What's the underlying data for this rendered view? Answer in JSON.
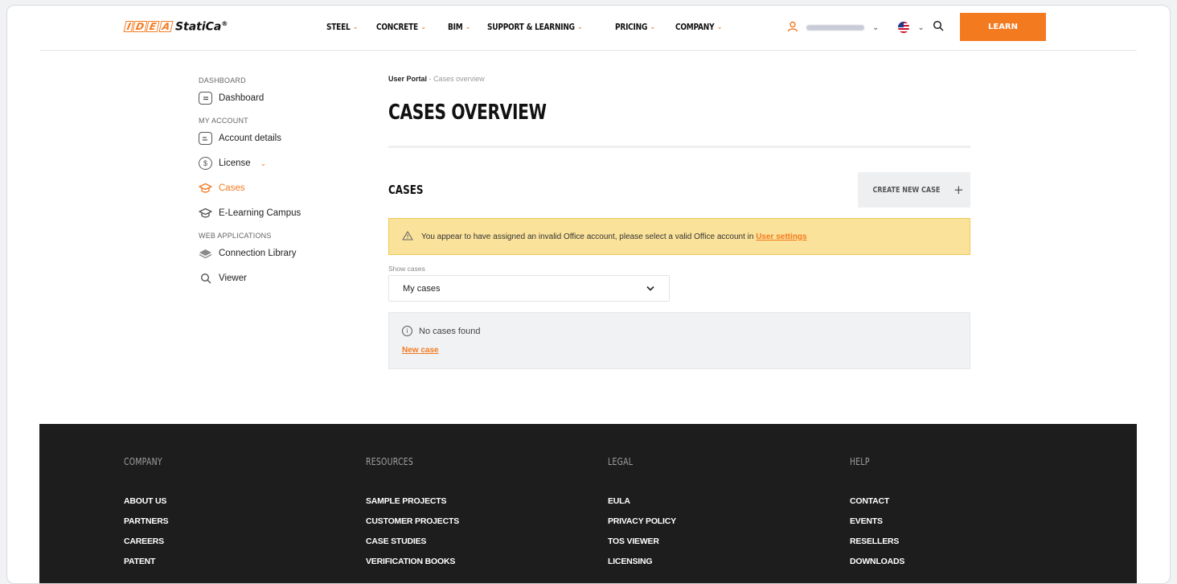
{
  "header": {
    "logo_mark": [
      "I",
      "D",
      "E",
      "A"
    ],
    "logo_text": "StatiCa",
    "logo_reg": "®",
    "nav": [
      {
        "label": "STEEL"
      },
      {
        "label": "CONCRETE"
      },
      {
        "label": "BIM"
      },
      {
        "label": "SUPPORT & LEARNING"
      },
      {
        "label": "PRICING"
      },
      {
        "label": "COMPANY"
      }
    ],
    "learn_label": "LEARN"
  },
  "sidebar": {
    "sections": [
      {
        "title": "DASHBOARD",
        "items": [
          {
            "label": "Dashboard",
            "icon": "dashboard-icon"
          }
        ]
      },
      {
        "title": "MY ACCOUNT",
        "items": [
          {
            "label": "Account details",
            "icon": "account-details-icon"
          },
          {
            "label": "License",
            "icon": "license-icon"
          },
          {
            "label": "Cases",
            "icon": "cases-icon",
            "active": true
          },
          {
            "label": "E-Learning Campus",
            "icon": "graduation-cap-icon"
          }
        ]
      },
      {
        "title": "WEB APPLICATIONS",
        "items": [
          {
            "label": "Connection Library",
            "icon": "layers-icon"
          },
          {
            "label": "Viewer",
            "icon": "search-icon"
          }
        ]
      }
    ]
  },
  "main": {
    "breadcrumb": {
      "root": "User Portal",
      "sep": "-",
      "current": "Cases overview"
    },
    "title": "CASES OVERVIEW",
    "cases_title": "CASES",
    "create_label": "CREATE NEW CASE",
    "create_plus": "+",
    "alert": {
      "text": "You appear to have assigned an invalid Office account, please select a valid Office account in",
      "link": "User settings"
    },
    "show_label": "Show cases",
    "select_value": "My cases",
    "empty_text": "No cases found",
    "new_case_link": "New case"
  },
  "footer": {
    "columns": [
      {
        "title": "COMPANY",
        "links": [
          "ABOUT US",
          "PARTNERS",
          "CAREERS",
          "PATENT"
        ]
      },
      {
        "title": "RESOURCES",
        "links": [
          "SAMPLE PROJECTS",
          "CUSTOMER PROJECTS",
          "CASE STUDIES",
          "VERIFICATION BOOKS"
        ]
      },
      {
        "title": "LEGAL",
        "links": [
          "EULA",
          "PRIVACY POLICY",
          "TOS VIEWER",
          "LICENSING"
        ]
      },
      {
        "title": "HELP",
        "links": [
          "CONTACT",
          "EVENTS",
          "RESELLERS",
          "DOWNLOADS"
        ]
      }
    ]
  },
  "colors": {
    "accent": "#f47a20",
    "alert_bg": "#fbe29a",
    "footer_bg": "#1d1d1d"
  }
}
